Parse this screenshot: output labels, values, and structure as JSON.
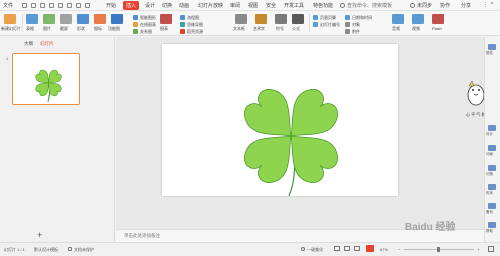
{
  "menubar": {
    "file_label": "文件",
    "items": [
      "开始",
      "插入",
      "设计",
      "切换",
      "动画",
      "幻灯片放映",
      "审阅",
      "视图",
      "安全",
      "开发工具",
      "特色功能"
    ],
    "active_index": 1,
    "search_placeholder": "查找命令、搜索模板",
    "share_label": "未同步",
    "collab_label": "协作",
    "share2_label": "分享"
  },
  "ribbon": {
    "big_buttons": [
      "新建幻灯片",
      "表格",
      "图片",
      "截屏",
      "形状",
      "图标",
      "功能图",
      "图表",
      "文本框",
      "艺术字",
      "符号",
      "公式"
    ],
    "small_buttons": [
      "智能图形",
      "在线图表",
      "关系图",
      "流程图",
      "思维导图",
      "稻壳资源",
      "页眉页脚",
      "幻灯片编号",
      "日期和时间",
      "对象",
      "附件",
      "音频",
      "视频",
      "Flash"
    ]
  },
  "left_panel": {
    "tab_outline": "大纲",
    "tab_slides": "幻灯片",
    "slide_number": "1"
  },
  "notes": {
    "placeholder": "单击此处添加备注"
  },
  "right_sidebar": {
    "items": [
      "属性",
      "设计",
      "动画",
      "切换",
      "形状",
      "备份",
      "帮助"
    ]
  },
  "status": {
    "slide_count": "幻灯片 1 / 1",
    "theme": "默认设计模板",
    "doc_protect": "文档未保护",
    "beautify": "一键美化",
    "zoom": "67%"
  },
  "watermark": {
    "text": "Baidu 经验"
  },
  "colors": {
    "accent": "#e8412d",
    "clover_fill": "#8ed44f",
    "clover_stroke": "#4a9a2a",
    "stem": "#3d9b3a"
  }
}
